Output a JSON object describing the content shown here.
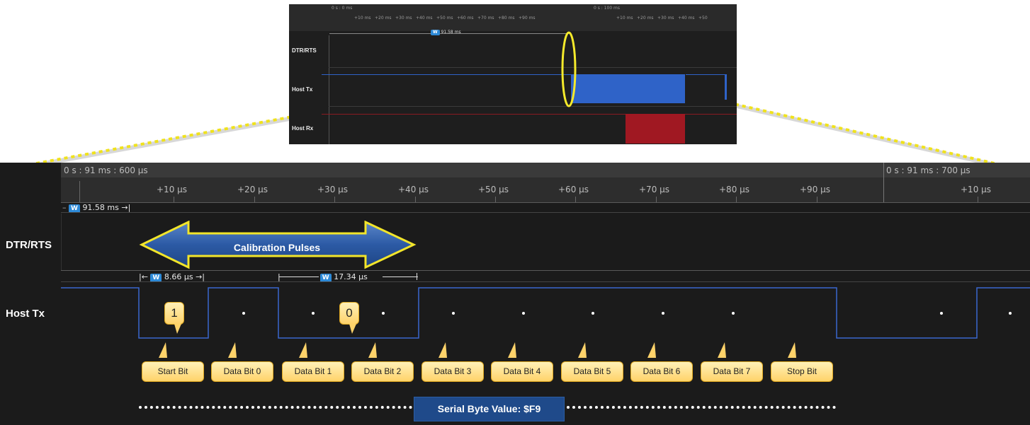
{
  "overview": {
    "time_left": "0 s : 0 ms",
    "time_right": "0 s : 100 ms",
    "ticks_left": [
      "+10 ms",
      "+20 ms",
      "+30 ms",
      "+40 ms",
      "+50 ms",
      "+60 ms",
      "+70 ms",
      "+80 ms",
      "+90 ms"
    ],
    "ticks_right": [
      "+10 ms",
      "+20 ms",
      "+30 ms",
      "+40 ms",
      "+50"
    ],
    "measure": "91.58 ms",
    "channels": [
      "DTR/RTS",
      "Host Tx",
      "Host Rx"
    ]
  },
  "main": {
    "time_left": "0 s : 91 ms : 600 μs",
    "time_right": "0 s : 91 ms : 700 μs",
    "ticks": [
      "+10 μs",
      "+20 μs",
      "+30 μs",
      "+40 μs",
      "+50 μs",
      "+60 μs",
      "+70 μs",
      "+80 μs",
      "+90 μs",
      "+10 μs"
    ],
    "measure_total": "91.58 ms",
    "measure_a": "8.66 μs",
    "measure_b": "17.34 μs",
    "channels": [
      "DTR/RTS",
      "Host Tx"
    ],
    "calibration_label": "Calibration Pulses",
    "bit_values": [
      "1",
      "0"
    ],
    "bit_labels": [
      "Start Bit",
      "Data Bit 0",
      "Data Bit 1",
      "Data Bit 2",
      "Data Bit 3",
      "Data Bit 4",
      "Data Bit 5",
      "Data Bit 6",
      "Data Bit 7",
      "Stop Bit"
    ],
    "byte_value": "Serial Byte Value: $F9",
    "badge": "W"
  },
  "colors": {
    "signal_tx": "#2f63c8",
    "signal_rx": "#a01822",
    "callout": "#ffd36a",
    "highlight": "#f5ea2b",
    "byte_box": "#1f4a8a"
  }
}
